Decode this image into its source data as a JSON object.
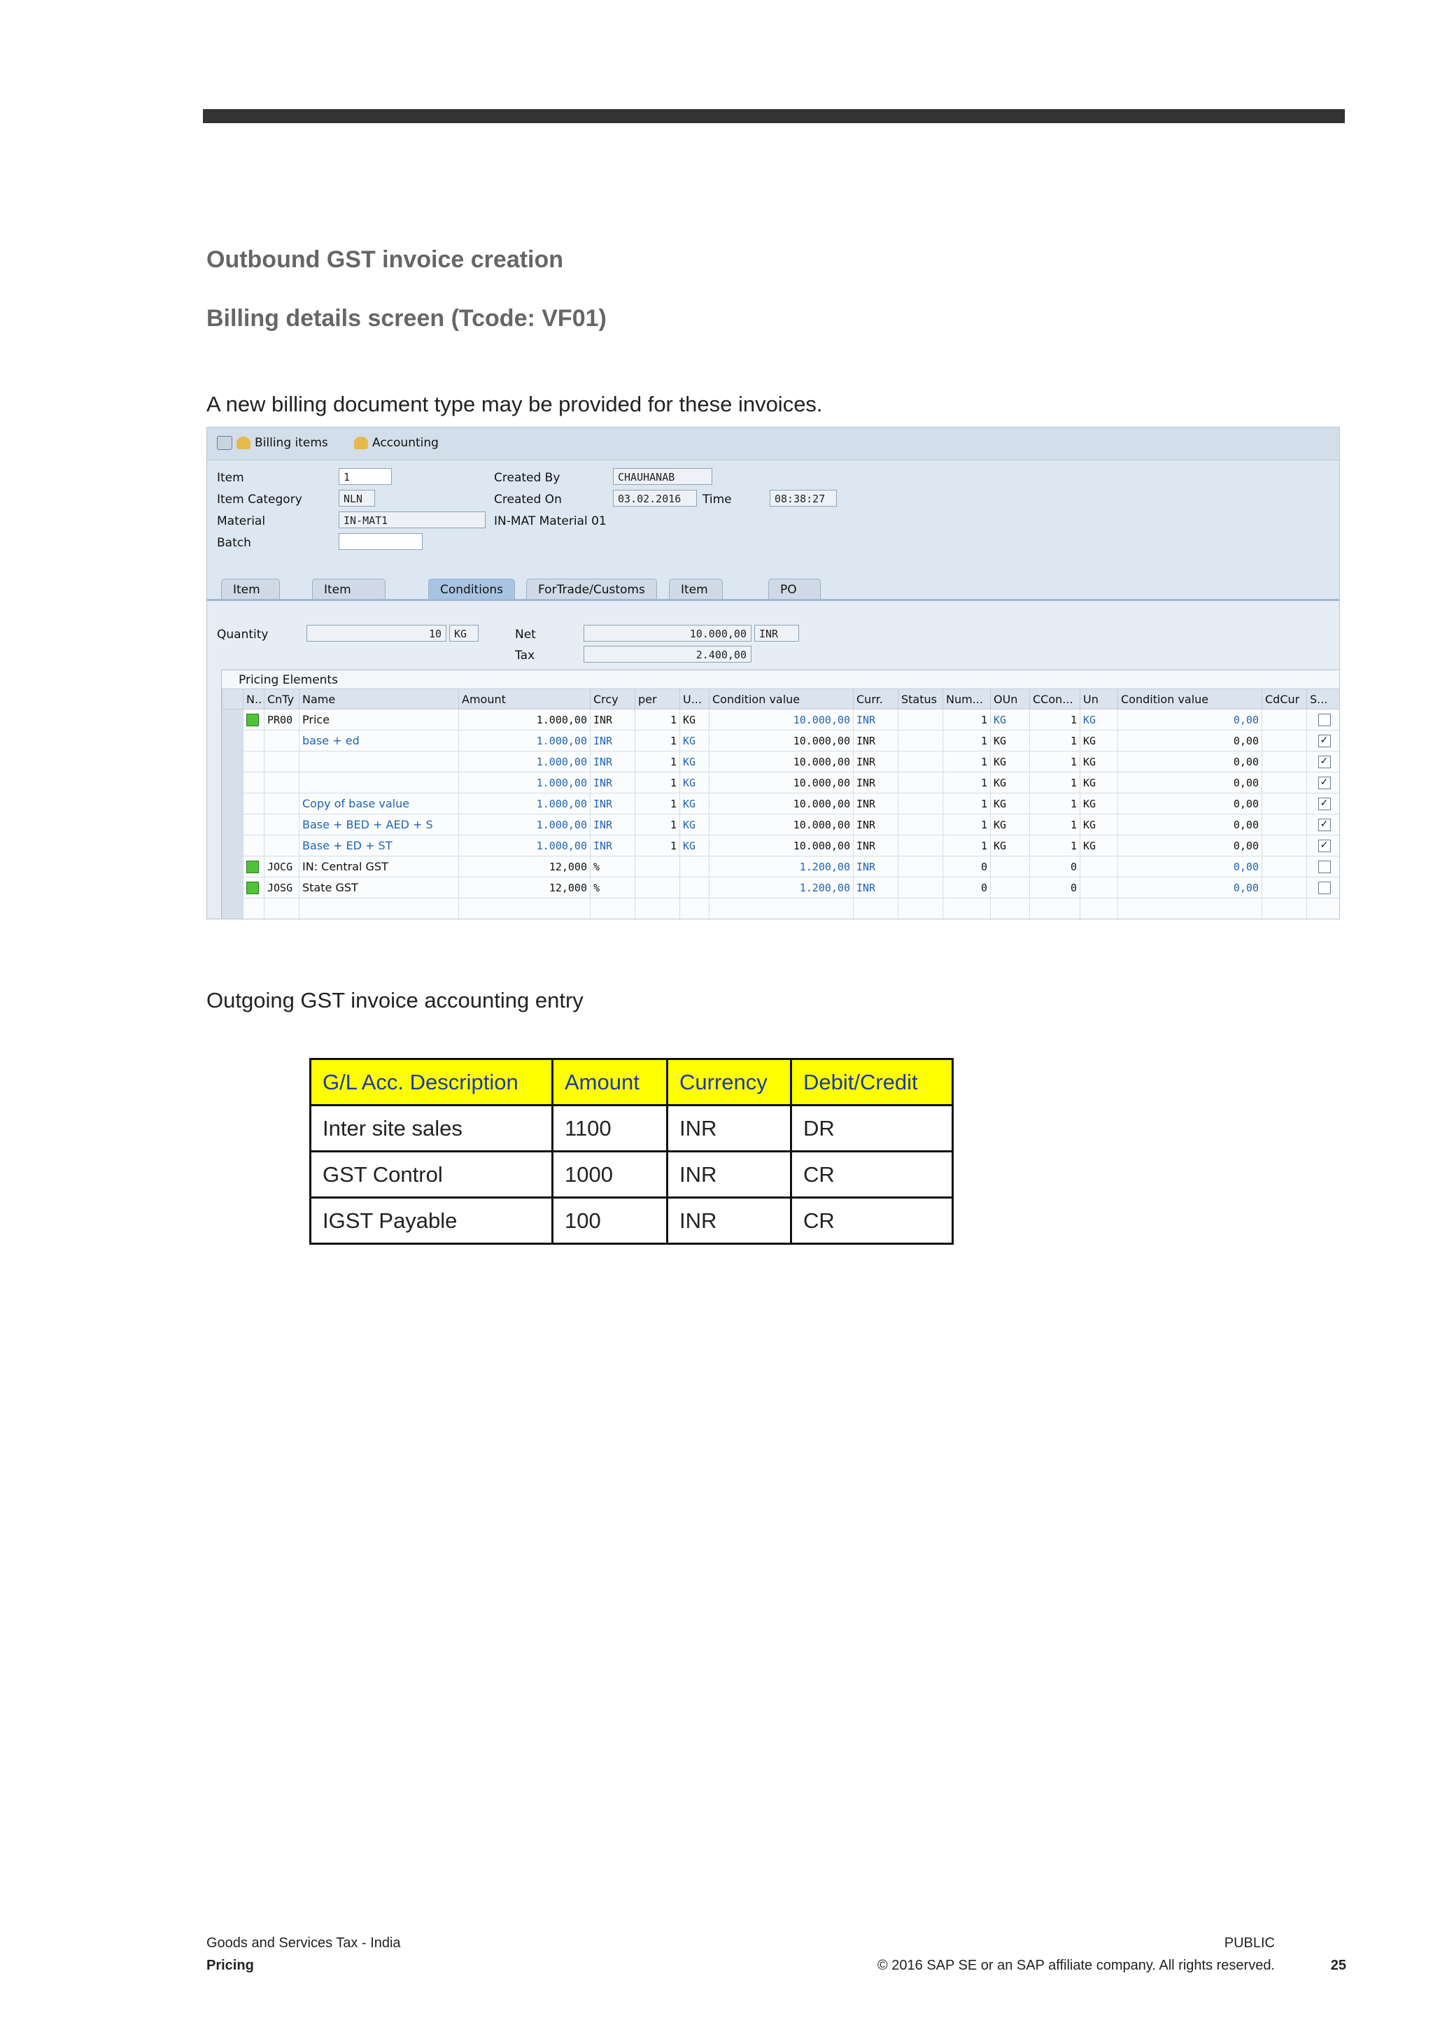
{
  "heading1": "Outbound GST invoice creation",
  "heading2": "Billing details screen (Tcode: VF01)",
  "intro": "A new billing document type may be provided for these invoices.",
  "sap": {
    "toolbar": {
      "billing_items": "Billing items",
      "accounting": "Accounting"
    },
    "header": {
      "item_label": "Item",
      "item_value": "1",
      "item_category_label": "Item Category",
      "item_category_value": "NLN",
      "material_label": "Material",
      "material_value": "IN-MAT1",
      "material_desc": "IN-MAT Material 01",
      "batch_label": "Batch",
      "batch_value": "",
      "created_by_label": "Created By",
      "created_by_value": "CHAUHANAB",
      "created_on_label": "Created On",
      "created_on_value": "03.02.2016",
      "time_label": "Time",
      "time_value": "08:38:27"
    },
    "tabs": [
      "Item Detail",
      "Item Partners",
      "Conditions",
      "ForTrade/Customs",
      "Item Texts",
      "PO Data"
    ],
    "conditions": {
      "quantity_label": "Quantity",
      "quantity_value": "10",
      "quantity_unit": "KG",
      "net_label": "Net",
      "net_value": "10.000,00",
      "net_curr": "INR",
      "tax_label": "Tax",
      "tax_value": "2.400,00",
      "pricing_title": "Pricing Elements",
      "columns": [
        "N..",
        "CnTy",
        "Name",
        "Amount",
        "Crcy",
        "per",
        "U...",
        "Condition value",
        "Curr.",
        "Status",
        "Num...",
        "OUn",
        "CCon...",
        "Un",
        "Condition value",
        "CdCur",
        "S..."
      ],
      "rows": [
        {
          "cnty": "PR00",
          "name": "Price",
          "amount": "1.000,00",
          "crcy": "INR",
          "per": "1",
          "u": "KG",
          "cval": "10.000,00",
          "curr": "INR",
          "num": "1",
          "oun": "KG",
          "ccon": "1",
          "un": "KG",
          "cval2": "0,00",
          "checked": "",
          "status": true,
          "blue": false
        },
        {
          "cnty": "",
          "name": "base + ed",
          "amount": "1.000,00",
          "crcy": "INR",
          "per": "1",
          "u": "KG",
          "cval": "10.000,00",
          "curr": "INR",
          "num": "1",
          "oun": "KG",
          "ccon": "1",
          "un": "KG",
          "cval2": "0,00",
          "checked": "✓",
          "status": false,
          "blue": true
        },
        {
          "cnty": "",
          "name": "",
          "amount": "1.000,00",
          "crcy": "INR",
          "per": "1",
          "u": "KG",
          "cval": "10.000,00",
          "curr": "INR",
          "num": "1",
          "oun": "KG",
          "ccon": "1",
          "un": "KG",
          "cval2": "0,00",
          "checked": "✓",
          "status": false,
          "blue": true
        },
        {
          "cnty": "",
          "name": "",
          "amount": "1.000,00",
          "crcy": "INR",
          "per": "1",
          "u": "KG",
          "cval": "10.000,00",
          "curr": "INR",
          "num": "1",
          "oun": "KG",
          "ccon": "1",
          "un": "KG",
          "cval2": "0,00",
          "checked": "✓",
          "status": false,
          "blue": true
        },
        {
          "cnty": "",
          "name": "Copy of base value",
          "amount": "1.000,00",
          "crcy": "INR",
          "per": "1",
          "u": "KG",
          "cval": "10.000,00",
          "curr": "INR",
          "num": "1",
          "oun": "KG",
          "ccon": "1",
          "un": "KG",
          "cval2": "0,00",
          "checked": "✓",
          "status": false,
          "blue": true
        },
        {
          "cnty": "",
          "name": "Base + BED + AED + S",
          "amount": "1.000,00",
          "crcy": "INR",
          "per": "1",
          "u": "KG",
          "cval": "10.000,00",
          "curr": "INR",
          "num": "1",
          "oun": "KG",
          "ccon": "1",
          "un": "KG",
          "cval2": "0,00",
          "checked": "✓",
          "status": false,
          "blue": true
        },
        {
          "cnty": "",
          "name": "Base + ED + ST",
          "amount": "1.000,00",
          "crcy": "INR",
          "per": "1",
          "u": "KG",
          "cval": "10.000,00",
          "curr": "INR",
          "num": "1",
          "oun": "KG",
          "ccon": "1",
          "un": "KG",
          "cval2": "0,00",
          "checked": "✓",
          "status": false,
          "blue": true
        },
        {
          "cnty": "JOCG",
          "name": "IN: Central GST",
          "amount": "12,000",
          "crcy": "%",
          "per": "",
          "u": "",
          "cval": "1.200,00",
          "curr": "INR",
          "num": "0",
          "oun": "",
          "ccon": "0",
          "un": "",
          "cval2": "0,00",
          "checked": "",
          "status": true,
          "blue": false
        },
        {
          "cnty": "JOSG",
          "name": "State GST",
          "amount": "12,000",
          "crcy": "%",
          "per": "",
          "u": "",
          "cval": "1.200,00",
          "curr": "INR",
          "num": "0",
          "oun": "",
          "ccon": "0",
          "un": "",
          "cval2": "0,00",
          "checked": "",
          "status": true,
          "blue": false
        }
      ]
    }
  },
  "accounting_title": "Outgoing GST invoice accounting entry",
  "accounting": {
    "headers": [
      "G/L Acc. Description",
      "Amount",
      "Currency",
      "Debit/Credit"
    ],
    "rows": [
      [
        "Inter site sales",
        "1100",
        "INR",
        "DR"
      ],
      [
        "GST Control",
        "1000",
        "INR",
        "CR"
      ],
      [
        "IGST Payable",
        "100",
        "INR",
        "CR"
      ]
    ]
  },
  "footer": {
    "left_top": "Goods and Services Tax - India",
    "left_bottom": "Pricing",
    "right_top": "PUBLIC",
    "right_bottom": "© 2016 SAP SE or an SAP affiliate company. All rights reserved.",
    "page": "25"
  },
  "colors": {
    "header_fill": "#ffff00",
    "header_text": "#1a3aa8",
    "status_green": "#4fc23a",
    "link_blue": "#1f64b5"
  }
}
